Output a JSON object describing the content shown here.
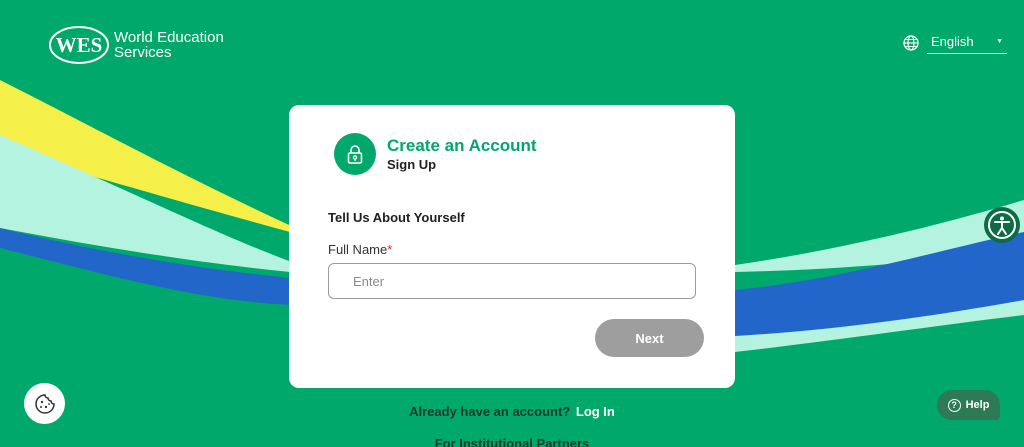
{
  "brand": {
    "logo_text": "WES",
    "name_line1": "World Education",
    "name_line2": "Services"
  },
  "language": {
    "selected": "English",
    "icon": "globe-icon"
  },
  "card": {
    "title": "Create an Account",
    "subtitle": "Sign Up",
    "icon": "lock-icon",
    "section_title": "Tell Us About Yourself",
    "full_name": {
      "label": "Full Name",
      "required_mark": "*",
      "placeholder": "Enter",
      "value": ""
    },
    "next_label": "Next"
  },
  "footer": {
    "login_prompt": "Already have an account?",
    "login_link": "Log In",
    "partners_link": "For Institutional Partners"
  },
  "help": {
    "label": "Help",
    "icon_glyph": "?"
  },
  "icons": {
    "cookie": "cookie-icon",
    "accessibility": "accessibility-icon"
  },
  "colors": {
    "background_green": "#00a86b",
    "wave_yellow": "#f5ef4a",
    "wave_mint": "#b3f3df",
    "wave_blue": "#2266c9",
    "next_button_disabled": "#9e9e9e"
  }
}
